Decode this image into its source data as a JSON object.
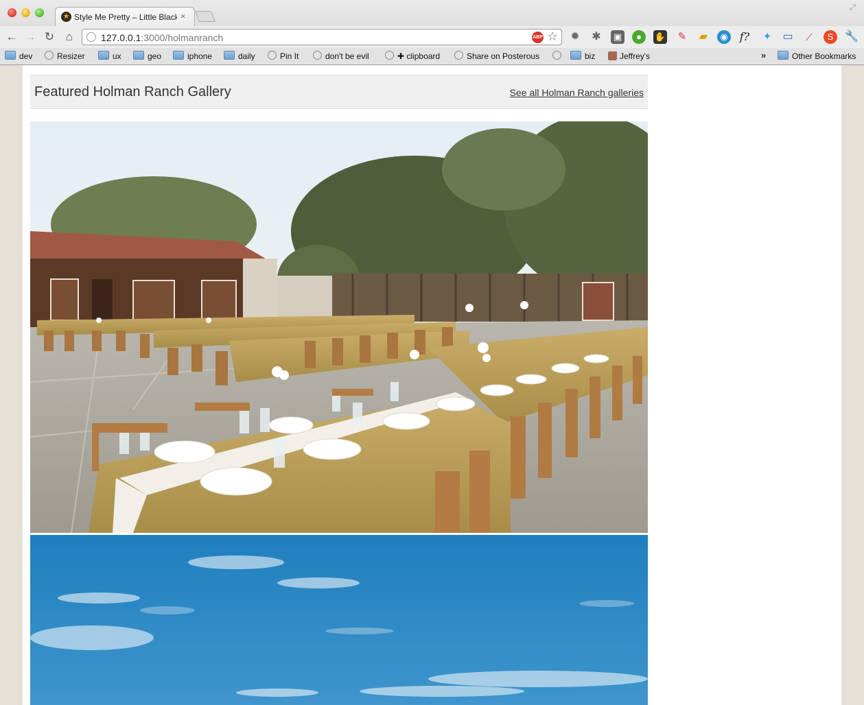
{
  "browser": {
    "tab_title": "Style Me Pretty – Little Black",
    "tab_close": "×",
    "url_host": "127.0.0.1",
    "url_rest": ":3000/holmanranch",
    "extensions": [
      "gear-icon",
      "puzzle-icon",
      "clipboard-icon",
      "green-circle-icon",
      "hand-icon",
      "network-icon",
      "truck-icon",
      "eye-icon",
      "font-icon",
      "bird-icon",
      "screen-icon",
      "graph-icon",
      "stumbleupon-icon",
      "wrench-icon"
    ],
    "ext_font_label": "f?",
    "bookmarks": [
      {
        "label": "dev",
        "kind": "folder"
      },
      {
        "label": "Resizer",
        "kind": "globe"
      },
      {
        "label": "ux",
        "kind": "folder"
      },
      {
        "label": "geo",
        "kind": "folder"
      },
      {
        "label": "iphone",
        "kind": "folder"
      },
      {
        "label": "daily",
        "kind": "folder"
      },
      {
        "label": "Pin It",
        "kind": "globe"
      },
      {
        "label": "don't be evil",
        "kind": "globe"
      },
      {
        "label": "✚ clipboard",
        "kind": "globe"
      },
      {
        "label": "Share on Posterous",
        "kind": "globe"
      },
      {
        "label": "",
        "kind": "globe"
      },
      {
        "label": "biz",
        "kind": "folder"
      },
      {
        "label": "Jeffrey's",
        "kind": "avatar"
      }
    ],
    "overflow_label": "»",
    "other_bookmarks": "Other Bookmarks"
  },
  "page": {
    "gallery_title": "Featured Holman Ranch Gallery",
    "see_all_link": "See all Holman Ranch galleries"
  },
  "colors": {
    "page_background": "#e6e1d6",
    "tablecloth": "#bfa15e",
    "sky": "#2d86c4"
  }
}
